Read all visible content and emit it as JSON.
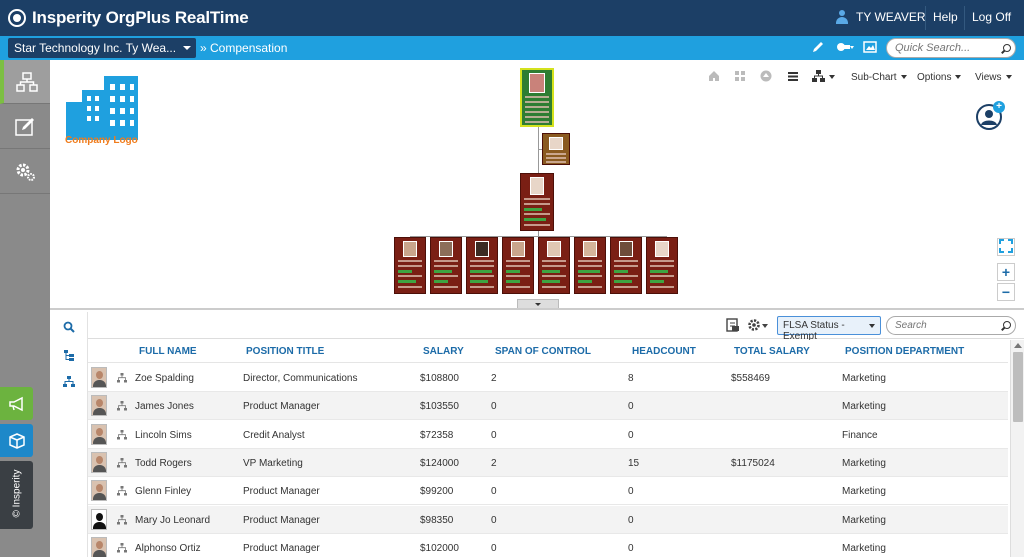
{
  "header": {
    "brand": "Insperity OrgPlus RealTime",
    "user_name": "TY WEAVER",
    "help_label": "Help",
    "logoff_label": "Log Off"
  },
  "subheader": {
    "company_select": "Star Technology Inc. Ty Wea...",
    "breadcrumb": "» Compensation",
    "quick_search_placeholder": "Quick Search..."
  },
  "sidebar": {
    "items": [
      "org-chart",
      "edit",
      "settings"
    ],
    "brand_label": "© Insperity"
  },
  "chart_toolbar": {
    "subchart_label": "Sub-Chart",
    "options_label": "Options",
    "views_label": "Views"
  },
  "company_logo_label": "Company Logo",
  "colors": {
    "topbar": "#1c3f66",
    "bluebar": "#1fa0df",
    "box": "#7a1f14",
    "accent_green": "#7cbf42",
    "header_text": "#1c6ba8"
  },
  "grid": {
    "filter_label": "FLSA Status - Exempt",
    "search_placeholder": "Search",
    "columns": [
      "FULL NAME",
      "POSITION TITLE",
      "SALARY",
      "SPAN OF CONTROL",
      "HEADCOUNT",
      "TOTAL SALARY",
      "POSITION DEPARTMENT"
    ],
    "rows": [
      {
        "name": "Zoe Spalding",
        "title": "Director, Communications",
        "salary": "$108800",
        "span": "2",
        "headcount": "8",
        "total": "$558469",
        "dept": "Marketing",
        "photo": "f"
      },
      {
        "name": "James Jones",
        "title": "Product Manager",
        "salary": "$103550",
        "span": "0",
        "headcount": "0",
        "total": "",
        "dept": "Marketing",
        "photo": "m"
      },
      {
        "name": "Lincoln Sims",
        "title": "Credit Analyst",
        "salary": "$72358",
        "span": "0",
        "headcount": "0",
        "total": "",
        "dept": "Finance",
        "photo": "m"
      },
      {
        "name": "Todd Rogers",
        "title": "VP Marketing",
        "salary": "$124000",
        "span": "2",
        "headcount": "15",
        "total": "$1175024",
        "dept": "Marketing",
        "photo": "m"
      },
      {
        "name": "Glenn Finley",
        "title": "Product Manager",
        "salary": "$99200",
        "span": "0",
        "headcount": "0",
        "total": "",
        "dept": "Marketing",
        "photo": "m"
      },
      {
        "name": "Mary Jo Leonard",
        "title": "Product Manager",
        "salary": "$98350",
        "span": "0",
        "headcount": "0",
        "total": "",
        "dept": "Marketing",
        "photo": "sil"
      },
      {
        "name": "Alphonso Ortiz",
        "title": "Product Manager",
        "salary": "$102000",
        "span": "0",
        "headcount": "0",
        "total": "",
        "dept": "Marketing",
        "photo": "m"
      }
    ]
  }
}
